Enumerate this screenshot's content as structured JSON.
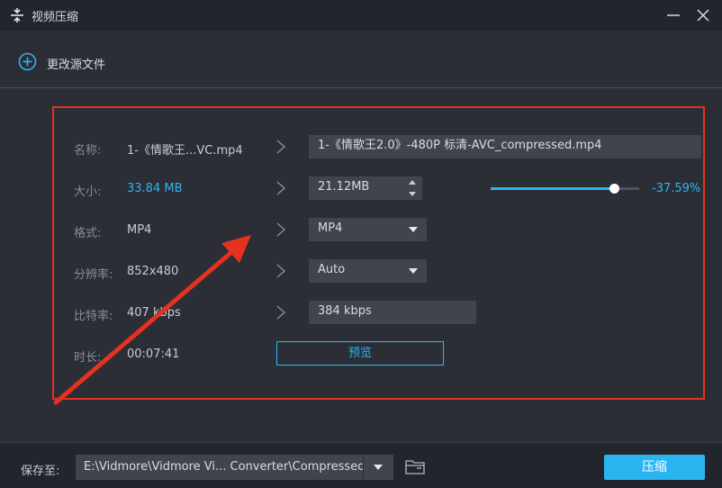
{
  "window": {
    "title": "视频压缩",
    "app_icon": "compress-icon",
    "minimize_icon": "minimize-icon",
    "close_icon": "close-icon"
  },
  "toolbar": {
    "add_icon": "plus-circle-icon",
    "change_source_label": "更改源文件"
  },
  "rows": {
    "name": {
      "label": "名称:",
      "source": "1-《情歌王...VC.mp4",
      "target": "1-《情歌王2.0》-480P 标清-AVC_compressed.mp4"
    },
    "size": {
      "label": "大小:",
      "source": "33.84 MB",
      "target": "21.12MB",
      "percent": "-37.59%",
      "slider_fraction": 0.83
    },
    "format": {
      "label": "格式:",
      "source": "MP4",
      "target": "MP4"
    },
    "resolution": {
      "label": "分辨率:",
      "source": "852x480",
      "target": "Auto"
    },
    "bitrate": {
      "label": "比特率:",
      "source": "407 kbps",
      "target": "384 kbps"
    },
    "duration": {
      "label": "时长:",
      "source": "00:07:41"
    }
  },
  "preview_label": "预览",
  "footer": {
    "save_to_label": "保存至:",
    "path": "E:\\Vidmore\\Vidmore Vi... Converter\\Compressed",
    "folder_icon": "folder-icon",
    "compress_label": "压缩"
  },
  "colors": {
    "accent": "#2bb5f0",
    "annotation_red": "#e5311f",
    "background": "#2c2e36",
    "titlebar": "#23252c"
  }
}
